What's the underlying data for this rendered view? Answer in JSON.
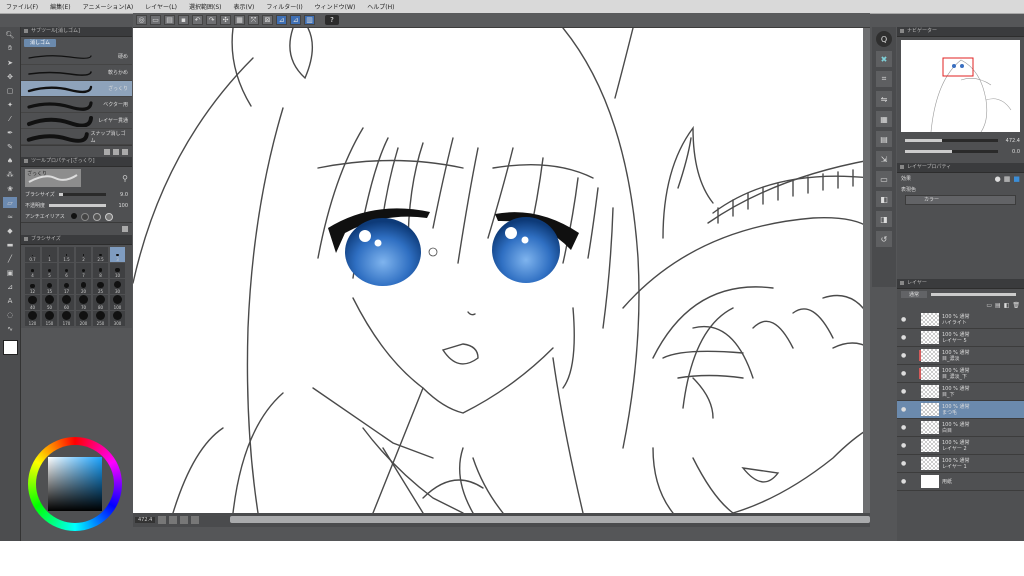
{
  "app": {
    "menu": [
      "ファイル(F)",
      "編集(E)",
      "アニメーション(A)",
      "レイヤー(L)",
      "選択範囲(S)",
      "表示(V)",
      "フィルター(I)",
      "ウィンドウ(W)",
      "ヘルプ(H)"
    ]
  },
  "subtool": {
    "panel_title": "サブツール[消しゴム]",
    "tab": "消しゴム",
    "brushes": [
      "硬め",
      "軟らかめ",
      "ざっくり",
      "ベクター用",
      "レイヤー貫通",
      "スナップ消しゴム"
    ],
    "selected": "ざっくり"
  },
  "toolprop": {
    "panel_title": "ツールプロパティ[ざっくり]",
    "preset": "ざっくり",
    "brush_size_label": "ブラシサイズ",
    "brush_size_value": "9.0",
    "opacity_label": "不透明度",
    "opacity_value": "100",
    "antialias_label": "アンチエイリアス",
    "opacity_fraction": 1.0,
    "size_fraction": 0.09
  },
  "brushsize": {
    "panel_title": "ブラシサイズ",
    "values": [
      "0.7",
      "1",
      "1.5",
      "2",
      "2.5",
      "3",
      "4",
      "5",
      "6",
      "7",
      "8",
      "10",
      "12",
      "15",
      "17",
      "20",
      "25",
      "30",
      "40",
      "50",
      "60",
      "70",
      "80",
      "100",
      "120",
      "150",
      "170",
      "200",
      "250",
      "300"
    ],
    "selected": "3"
  },
  "status": {
    "zoom": "472.4"
  },
  "navigator": {
    "panel_title": "ナビゲーター",
    "zoom_value": "472.4",
    "angle_value": "0.0"
  },
  "layerprop": {
    "panel_title": "レイヤープロパティ",
    "effect_label": "効果",
    "color_label": "表現色",
    "color_value": "カラー"
  },
  "layers": {
    "panel_title": "レイヤー",
    "blend_mode": "通常",
    "opacity": "100",
    "items": [
      {
        "opacity": "100 % 通常",
        "name": "ハイライト",
        "selected": false,
        "marked": false,
        "thumb": "check"
      },
      {
        "opacity": "100 % 通常",
        "name": "レイヤー 5",
        "selected": false,
        "marked": false,
        "thumb": "check"
      },
      {
        "opacity": "100 % 通常",
        "name": "目_濃淡",
        "selected": false,
        "marked": true,
        "thumb": "check"
      },
      {
        "opacity": "100 % 通常",
        "name": "目_濃淡_下",
        "selected": false,
        "marked": true,
        "thumb": "check"
      },
      {
        "opacity": "100 % 通常",
        "name": "目_下",
        "selected": false,
        "marked": false,
        "thumb": "check"
      },
      {
        "opacity": "100 % 通常",
        "name": "まつ毛",
        "selected": true,
        "marked": false,
        "thumb": "check"
      },
      {
        "opacity": "100 % 通常",
        "name": "白目",
        "selected": false,
        "marked": false,
        "thumb": "check"
      },
      {
        "opacity": "100 % 通常",
        "name": "レイヤー 2",
        "selected": false,
        "marked": false,
        "thumb": "check"
      },
      {
        "opacity": "100 % 通常",
        "name": "レイヤー 1",
        "selected": false,
        "marked": false,
        "thumb": "check"
      },
      {
        "opacity": "",
        "name": "用紙",
        "selected": false,
        "marked": false,
        "thumb": "white"
      }
    ]
  },
  "colors": {
    "accent": "#6b8aad",
    "iris_dark": "#0d3a78",
    "iris_light": "#4a8fd8",
    "lineart": "#4a4a4a"
  }
}
